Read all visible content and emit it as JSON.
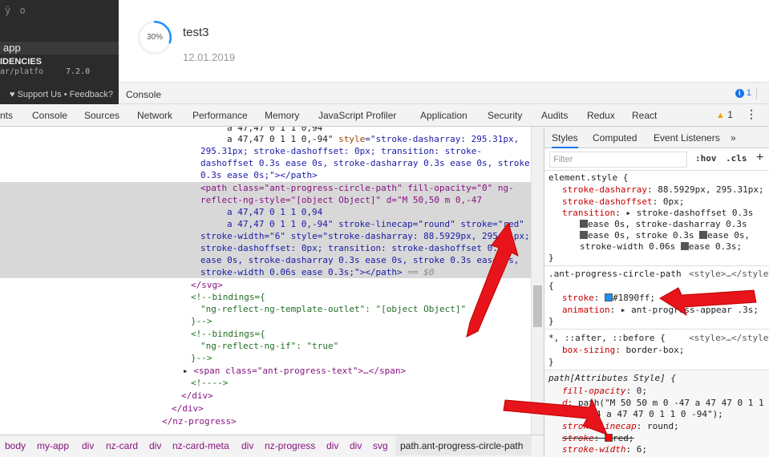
{
  "topleft": {
    "glyphs": "ÿ ο",
    "app_label": "app",
    "deps_label": "IDENCIES",
    "path_fragment": "ar/platfo",
    "version": "7.2.0",
    "support_label": "Support Us",
    "feedback_label": "Feedback?"
  },
  "card": {
    "progress_text": "30%",
    "progress_value": 0.3,
    "progress_color": "#1890ff",
    "title": "test3",
    "date": "12.01.2019"
  },
  "drawer": {
    "label": "Console",
    "info_count": "1"
  },
  "tabs": [
    "nts",
    "Console",
    "Sources",
    "Network",
    "Performance",
    "Memory",
    "JavaScript Profiler",
    "Application",
    "Security",
    "Audits",
    "Redux",
    "React"
  ],
  "warning_count": "1",
  "code": {
    "l0": "a 47,47 0 1 1 0,94",
    "l1a": "a 47,47 0 1 1 0,-94\" ",
    "l1b": "style",
    "l1c": "=\"stroke-dasharray: 295.31px,",
    "l2": "295.31px; stroke-dashoffset: 0px; transition: stroke-",
    "l3": "dashoffset 0.3s ease 0s, stroke-dasharray 0.3s ease 0s, stroke",
    "l4": "0.3s ease 0s;\"></path>",
    "l5": "<path class=\"ant-progress-circle-path\" fill-opacity=\"0\" ng-",
    "l6": "reflect-ng-style=\"[object Object]\" d=\"M 50,50 m 0,-47",
    "l7": "a 47,47 0 1 1 0,94",
    "l8": "a 47,47 0 1 1 0,-94\" stroke-linecap=\"round\" stroke=\"red\"",
    "l9": "stroke-width=\"6\" style=\"stroke-dasharray: 88.5929px, 295.31px;",
    "l10": "stroke-dashoffset: 0px; transition: stroke-dashoffset 0.3s",
    "l11": "ease 0s, stroke-dasharray 0.3s ease 0s, stroke 0.3s ease 0s,",
    "l12": "stroke-width 0.06s ease 0.3s;\"></path>",
    "l12b": " == $0",
    "l13": "</svg>",
    "l14": "<!--bindings={",
    "l15": "\"ng-reflect-ng-template-outlet\": \"[object Object]\"",
    "l16": "}-->",
    "l17": "<!--bindings={",
    "l18": "\"ng-reflect-ng-if\": \"true\"",
    "l19": "}-->",
    "l20": "<span class=\"ant-progress-text\">…</span>",
    "l21": "<!---->",
    "l22": "</div>",
    "l23": "</div>",
    "l24": "</nz-progress>"
  },
  "breadcrumbs": [
    "body",
    "my-app",
    "div",
    "nz-card",
    "div",
    "nz-card-meta",
    "div",
    "nz-progress",
    "div",
    "div",
    "svg",
    "path.ant-progress-circle-path"
  ],
  "styles_tabs": [
    "Styles",
    "Computed",
    "Event Listeners",
    "»"
  ],
  "filter_placeholder": "Filter",
  "hov": ":hov",
  "cls": ".cls",
  "plus": "+",
  "rules": {
    "r1_sel": "element.style {",
    "r1_p1n": "stroke-dasharray",
    "r1_p1v": ": 88.5929px, 295.31px;",
    "r1_p2n": "stroke-dashoffset",
    "r1_p2v": ": 0px;",
    "r1_p3n": "transition",
    "r1_p3v": ": ▸ stroke-dashoffset 0.3s",
    "r1_p3v2": "ease 0s, stroke-dasharray 0.3s",
    "r1_p3v3": "ease 0s, stroke 0.3s ",
    "r1_p3v3b": "ease 0s,",
    "r1_p3v4": "stroke-width 0.06s ",
    "r1_p3v4b": "ease 0.3s;",
    "close": "}",
    "r2_sel": ".ant-progress-circle-path",
    "r2_src": "<style>…</style>",
    "r2_open": "{",
    "r2_p1n": "stroke",
    "r2_p1v": "#1890ff;",
    "r2_p2n": "animation",
    "r2_p2v": ": ▸ ant-progress-appear .3s;",
    "r3_sel": "*, ::after, ::before {",
    "r3_src": "<style>…</style>",
    "r3_p1n": "box-sizing",
    "r3_p1v": ": border-box;",
    "r4_sel": "path[Attributes Style] {",
    "r4_p1n": "fill-opacity",
    "r4_p1v": ": 0;",
    "r4_p2n": "d",
    "r4_p2v": ": path(\"M 50 50 m 0 -47 a 47 47 0 1 1",
    "r4_p2v2": "0 94 a 47 47 0 1 1 0 -94\");",
    "r4_p3n": "stroke-linecap",
    "r4_p3v": ": round;",
    "r4_p4n": "stroke",
    "r4_p4v": "red;",
    "r4_p5n": "stroke-width",
    "r4_p5v": ": 6;"
  },
  "colors": {
    "accent": "#1890ff",
    "annotation_arrow": "#e8141c",
    "swatch_blue": "#1890ff",
    "swatch_red": "#ff0000"
  }
}
